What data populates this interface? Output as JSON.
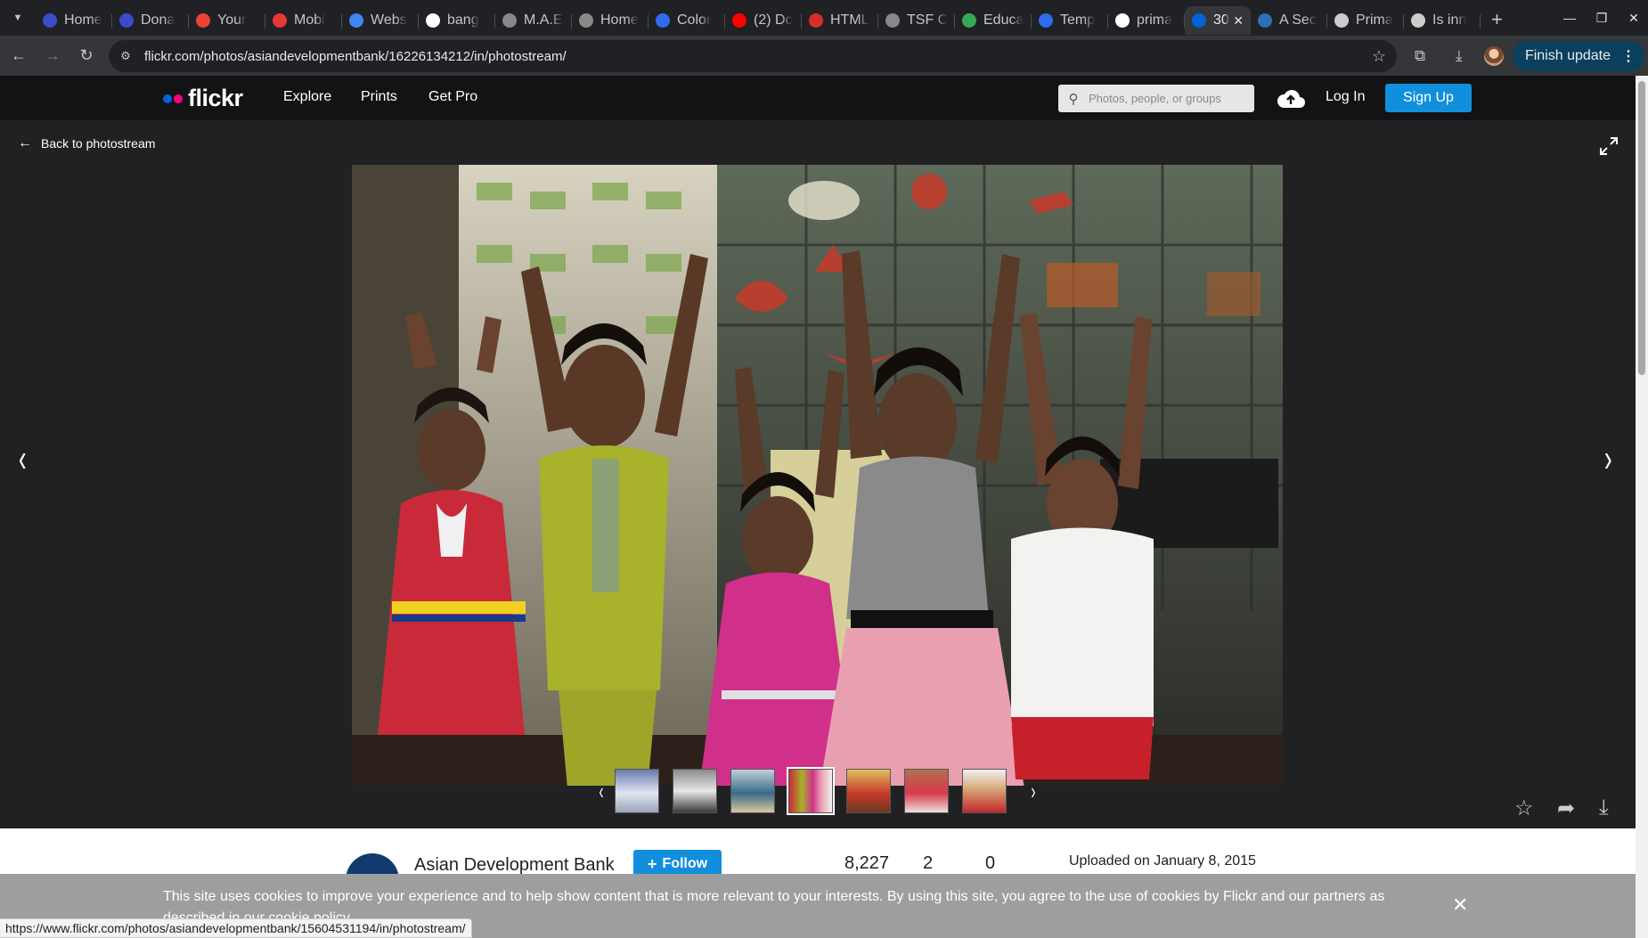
{
  "browser": {
    "tabs": [
      {
        "title": "Home",
        "favicon": "globe-icon",
        "color": "#3b4cca"
      },
      {
        "title": "Dona",
        "favicon": "globe-icon",
        "color": "#3b4cca"
      },
      {
        "title": "Your",
        "favicon": "gmail-icon",
        "color": "#ea4335"
      },
      {
        "title": "Mobi",
        "favicon": "app-icon",
        "color": "#e53935"
      },
      {
        "title": "Webs",
        "favicon": "docs-icon",
        "color": "#4285f4"
      },
      {
        "title": "bang",
        "favicon": "google-icon",
        "color": "#ffffff"
      },
      {
        "title": "M.A.E",
        "favicon": "globe-icon",
        "color": "#888888"
      },
      {
        "title": "Home",
        "favicon": "globe-icon",
        "color": "#888888"
      },
      {
        "title": "Color",
        "favicon": "canva-icon",
        "color": "#2f6bf0"
      },
      {
        "title": "(2) Dc",
        "favicon": "youtube-icon",
        "color": "#ff0000"
      },
      {
        "title": "HTML",
        "favicon": "d-icon",
        "color": "#d32f2f"
      },
      {
        "title": "TSF C",
        "favicon": "globe-icon",
        "color": "#888888"
      },
      {
        "title": "Educa",
        "favicon": "triangle-icon",
        "color": "#34a853"
      },
      {
        "title": "Temp",
        "favicon": "canva-icon",
        "color": "#2f6bf0"
      },
      {
        "title": "prima",
        "favicon": "google-icon",
        "color": "#ffffff"
      },
      {
        "title": "30",
        "favicon": "flickr-icon",
        "color": "#0063dc",
        "active": true
      },
      {
        "title": "A Sec",
        "favicon": "globe-icon",
        "color": "#2b6fb5"
      },
      {
        "title": "Prima",
        "favicon": "doc-icon",
        "color": "#cccccc"
      },
      {
        "title": "Is inn",
        "favicon": "doc-icon",
        "color": "#cccccc"
      }
    ],
    "url": "flickr.com/photos/asiandevelopmentbank/16226134212/in/photostream/",
    "finish_update": "Finish update",
    "status_url": "https://www.flickr.com/photos/asiandevelopmentbank/15604531194/in/photostream/"
  },
  "header": {
    "logo": "flickr",
    "nav": [
      "Explore",
      "Prints",
      "Get Pro"
    ],
    "search_placeholder": "Photos, people, or groups",
    "login": "Log In",
    "signup": "Sign Up",
    "accent": "#128fdc"
  },
  "photo_view": {
    "back_label": "Back to photostream"
  },
  "info": {
    "owner": "Asian Development Bank",
    "follow": "Follow",
    "stats": [
      "8,227",
      "2",
      "0"
    ],
    "uploaded": "Uploaded on January 8, 2015"
  },
  "cookie": {
    "text": "This site uses cookies to improve your experience and to help show content that is more relevant to your interests. By using this site, you agree to the use of cookies by Flickr and our partners as described in our cookie policy."
  }
}
